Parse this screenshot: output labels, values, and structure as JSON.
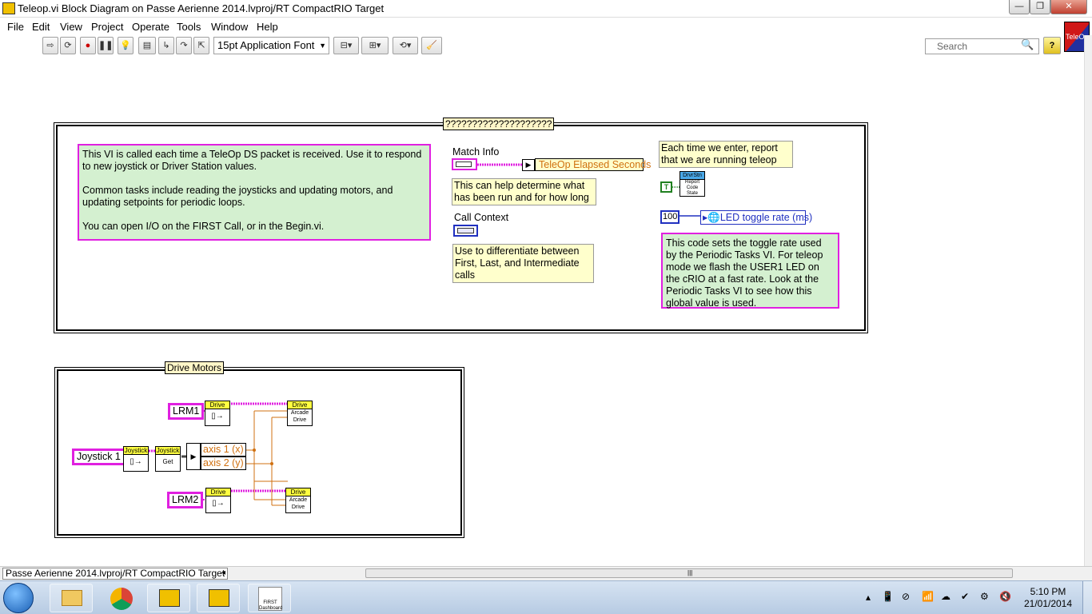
{
  "window": {
    "title": "Teleop.vi Block Diagram on Passe Aerienne 2014.lvproj/RT CompactRIO Target",
    "buttons": {
      "minimize": "—",
      "restore": "❐",
      "close": "✕"
    }
  },
  "menu": [
    "File",
    "Edit",
    "View",
    "Project",
    "Operate",
    "Tools",
    "Window",
    "Help"
  ],
  "toolbar": {
    "font_select": "15pt Application Font",
    "search_placeholder": "Search",
    "help_label": "?",
    "vi_icon_label": "TeleOp"
  },
  "diagram": {
    "main_frame_label": "????????????????????",
    "comment_main": [
      "This VI is called each time a TeleOp DS packet is received.  Use it to respond to new joystick or Driver Station values.",
      "Common tasks include reading the joysticks and updating motors, and updating setpoints for periodic loops.",
      "You can open I/O on the FIRST Call, or in the Begin.vi."
    ],
    "match_info_label": "Match Info",
    "teleop_elapsed": "TeleOp Elapsed Seconds",
    "note_match": "This can help determine what has been run and for how long",
    "call_context_label": "Call Context",
    "note_call": "Use to differentiate between First, Last, and Intermediate calls",
    "note_report": "Each time we enter, report that we are running teleop",
    "true_const": "T",
    "drvstn_header": "DrvrStn",
    "drvstn_body": "Report Code State",
    "led_const": "100",
    "led_global": "LED toggle rate (ms)",
    "comment_led": "This code sets the toggle rate used by the Periodic Tasks VI.  For teleop mode we flash the USER1 LED on the cRIO at a fast rate.  Look at the Periodic Tasks VI to see how this global value is used.",
    "drive_frame_label": "Drive Motors",
    "lrm1": "LRM1",
    "lrm2": "LRM2",
    "joystick1": "Joystick 1",
    "drive_hdr": "Drive",
    "joystick_hdr": "Joystick",
    "get_label": "Get",
    "arcade_label": "Arcade Drive",
    "axis1": "axis 1 (x)",
    "axis2": "axis 2 (y)"
  },
  "statusbar": {
    "project_path": "Passe Aerienne 2014.lvproj/RT CompactRIO Target"
  },
  "taskbar": {
    "first_dashboard": "FIRST Dashboard",
    "time": "5:10 PM",
    "date": "21/01/2014"
  },
  "colors": {
    "wire_pink": "#e020e0",
    "wire_orange": "#d07010",
    "comment_bg": "#d4f0d0",
    "note_bg": "#ffffcc",
    "subvi_hdr": "#ffff40"
  }
}
